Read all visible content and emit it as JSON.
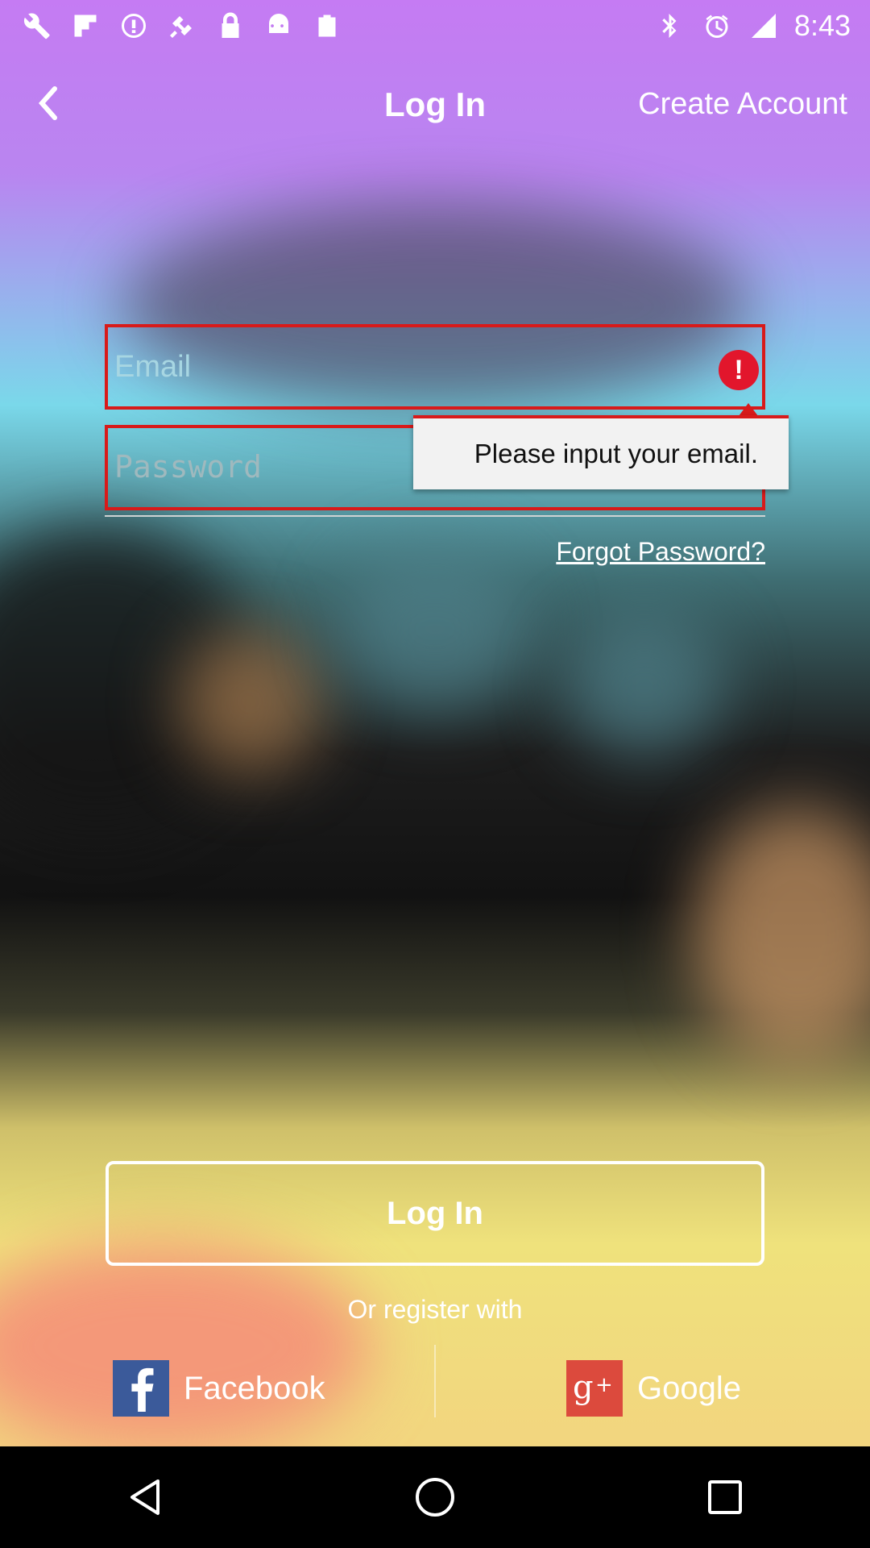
{
  "status_bar": {
    "time": "8:43",
    "left_icons": [
      "wrench-icon",
      "flipboard-icon",
      "info-circle-icon",
      "fake-gps-icon",
      "lock-icon",
      "android-icon",
      "clipboard-check-icon"
    ],
    "right_icons": [
      "bluetooth-icon",
      "alarm-icon",
      "signal-icon"
    ]
  },
  "header": {
    "title": "Log In",
    "create_account": "Create Account"
  },
  "form": {
    "email_placeholder": "Email",
    "password_placeholder": "Password",
    "email_error": "Please input your email.",
    "forgot_password": "Forgot Password?"
  },
  "actions": {
    "login_label": "Log In",
    "or_register": "Or register with",
    "facebook_label": "Facebook",
    "google_label": "Google"
  },
  "colors": {
    "error_red": "#d81a1a",
    "facebook_blue": "#3b5a9a",
    "google_red": "#dc4a3d"
  }
}
